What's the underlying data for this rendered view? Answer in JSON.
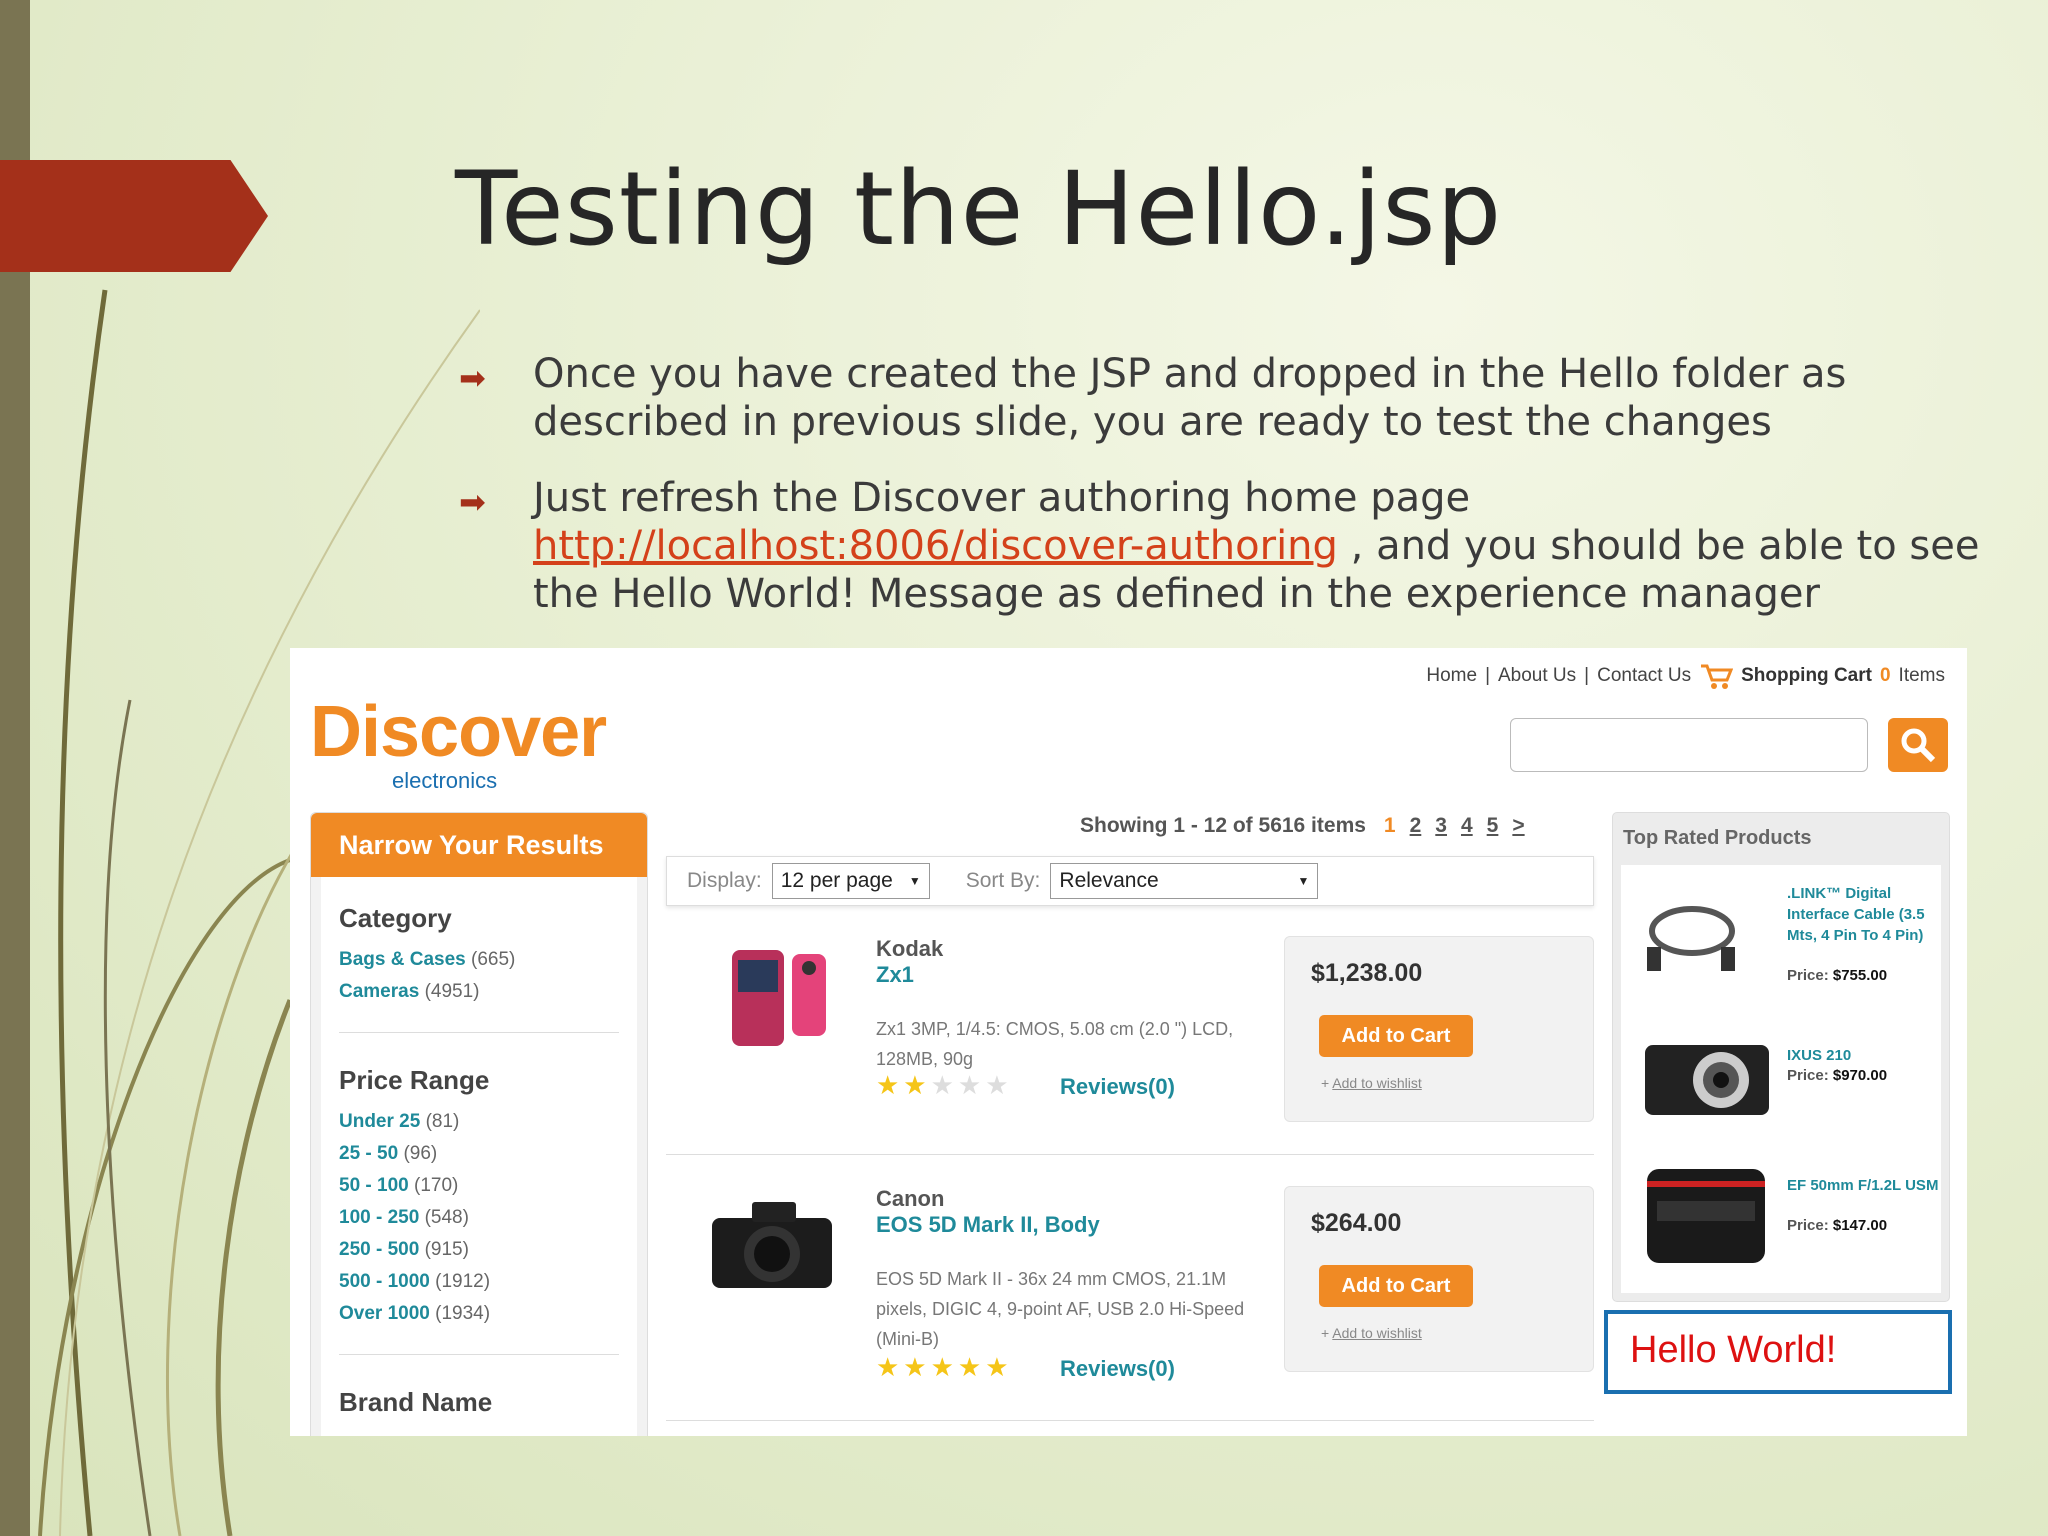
{
  "slide": {
    "title": "Testing the Hello.jsp",
    "bullet1": "Once you have created the JSP and dropped in the Hello folder as described in previous slide, you are ready to test the changes",
    "bullet2_pre": "Just refresh the Discover authoring home page ",
    "bullet2_link": "http://localhost:8006/discover-authoring",
    "bullet2_post": " , and you should be able to see the Hello World! Message as defined in the experience manager",
    "colors": {
      "accent": "#a4301a",
      "link": "#d4411a",
      "brand": "#f08a24",
      "teal": "#1f8a9a"
    }
  },
  "site": {
    "toplinks": {
      "home": "Home",
      "about": "About Us",
      "contact": "Contact Us",
      "cart": "Shopping Cart",
      "cart_count": "0",
      "items": "Items",
      "sep": "|"
    },
    "logo": {
      "big": "Discover",
      "small": "electronics"
    },
    "narrow": {
      "title": "Narrow Your Results",
      "category": "Category",
      "cats": [
        {
          "name": "Bags & Cases",
          "count": "(665)"
        },
        {
          "name": "Cameras",
          "count": "(4951)"
        }
      ],
      "price_range": "Price Range",
      "prices": [
        {
          "name": "Under 25",
          "count": "(81)"
        },
        {
          "name": "25 - 50",
          "count": "(96)"
        },
        {
          "name": "50 - 100",
          "count": "(170)"
        },
        {
          "name": "100 - 250",
          "count": "(548)"
        },
        {
          "name": "250 - 500",
          "count": "(915)"
        },
        {
          "name": "500 - 1000",
          "count": "(1912)"
        },
        {
          "name": "Over 1000",
          "count": "(1934)"
        }
      ],
      "brand": "Brand Name"
    },
    "showing": "Showing 1 - 12 of 5616 items",
    "pages": [
      "1",
      "2",
      "3",
      "4",
      "5",
      ">"
    ],
    "display_label": "Display:",
    "display_value": "12 per page",
    "sort_label": "Sort By:",
    "sort_value": "Relevance",
    "products": [
      {
        "brand": "Kodak",
        "name": "Zx1",
        "desc": "Zx1 3MP, 1/4.5: CMOS, 5.08 cm (2.0 \") LCD, 128MB, 90g",
        "rating": 2,
        "reviews": "Reviews(0)",
        "price": "$1,238.00",
        "add": "Add to Cart",
        "wish": "Add to wishlist"
      },
      {
        "brand": "Canon",
        "name": "EOS 5D Mark II, Body",
        "desc": "EOS 5D Mark II - 36x 24 mm CMOS, 21.1M pixels, DIGIC 4, 9-point AF, USB 2.0 Hi-Speed (Mini-B)",
        "rating": 5,
        "reviews": "Reviews(0)",
        "price": "$264.00",
        "add": "Add to Cart",
        "wish": "Add to wishlist"
      }
    ],
    "top_rated": {
      "title": "Top Rated Products",
      "items": [
        {
          "name": ".LINK™ Digital Interface Cable (3.5 Mts, 4 Pin To 4 Pin)",
          "price_label": "Price:",
          "price": "$755.00"
        },
        {
          "name": "IXUS 210",
          "price_label": "Price:",
          "price": "$970.00"
        },
        {
          "name": "EF 50mm F/1.2L USM",
          "price_label": "Price:",
          "price": "$147.00"
        }
      ]
    },
    "hello": "Hello World!"
  }
}
